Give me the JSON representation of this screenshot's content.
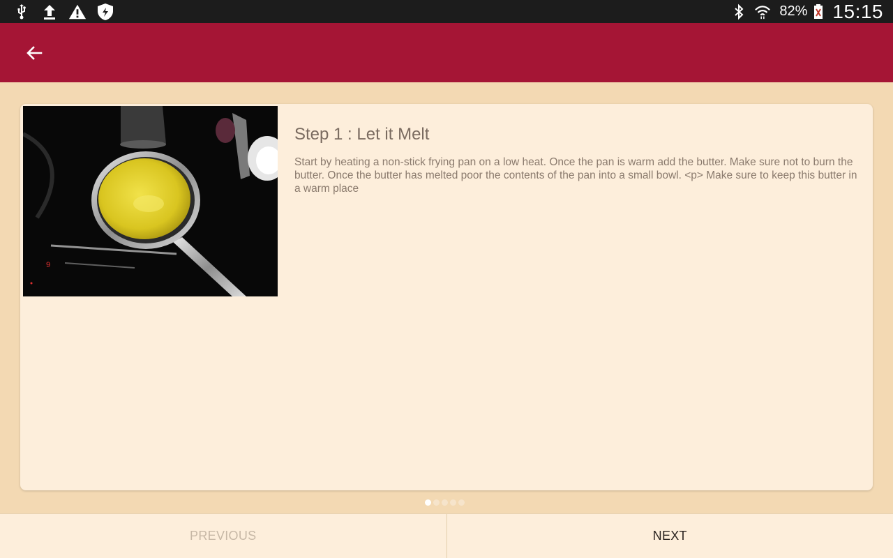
{
  "status_bar": {
    "left_icons": [
      "usb-icon",
      "upload-icon",
      "warning-icon",
      "shield-icon"
    ],
    "right_icons": [
      "bluetooth-icon",
      "wifi-icon"
    ],
    "battery_percent": "82%",
    "time": "15:15"
  },
  "app_bar": {
    "back_icon": "arrow-left-icon",
    "color": "#a51535"
  },
  "step": {
    "title": "Step 1 :  Let it Melt",
    "body": "Start by heating a non-stick frying pan on a low heat. Once the pan is warm add the butter. Make sure not to burn the butter. Once the butter has melted poor the contents of the pan into a small bowl. <p> Make sure to keep this butter in a warm place",
    "photo_icon": "melted-butter-pan-photo"
  },
  "pager": {
    "total": 5,
    "current": 1
  },
  "nav": {
    "previous_label": "PREVIOUS",
    "next_label": "NEXT"
  },
  "colors": {
    "background": "#f3d9b3",
    "card": "#fdeedb",
    "accent": "#a51535"
  }
}
